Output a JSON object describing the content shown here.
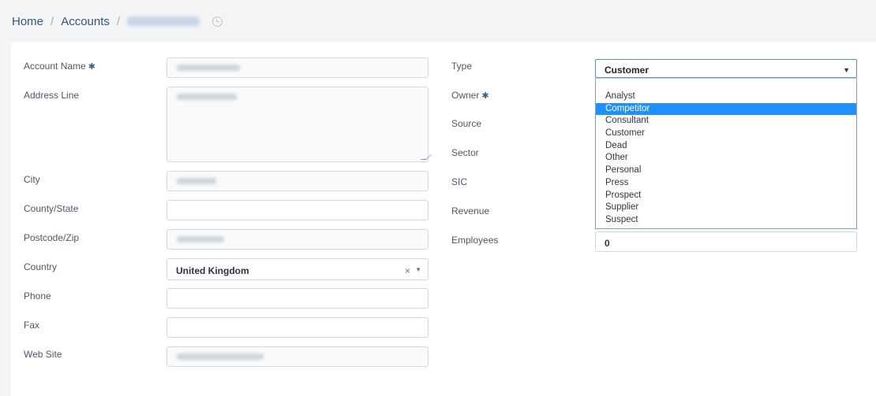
{
  "breadcrumb": {
    "home": "Home",
    "separator": "/",
    "accounts": "Accounts"
  },
  "form": {
    "left": {
      "account_name_label": "Account Name",
      "address_label": "Address Line",
      "city_label": "City",
      "county_label": "County/State",
      "postcode_label": "Postcode/Zip",
      "country_label": "Country",
      "country_value": "United Kingdom",
      "phone_label": "Phone",
      "fax_label": "Fax",
      "website_label": "Web Site"
    },
    "right": {
      "type_label": "Type",
      "type_value": "Customer",
      "owner_label": "Owner",
      "source_label": "Source",
      "sector_label": "Sector",
      "sic_label": "SIC",
      "revenue_label": "Revenue",
      "employees_label": "Employees",
      "employees_value": "0"
    },
    "required_marker": "✱",
    "clear_icon": "×",
    "dropdown_icon": "▼"
  },
  "type_options": [
    "Analyst",
    "Competitor",
    "Consultant",
    "Customer",
    "Dead",
    "Other",
    "Personal",
    "Press",
    "Prospect",
    "Supplier",
    "Suspect"
  ],
  "type_highlighted": "Competitor",
  "colors": {
    "accent": "#1e90ff",
    "link": "#34577c",
    "background": "#f3f4f6"
  }
}
